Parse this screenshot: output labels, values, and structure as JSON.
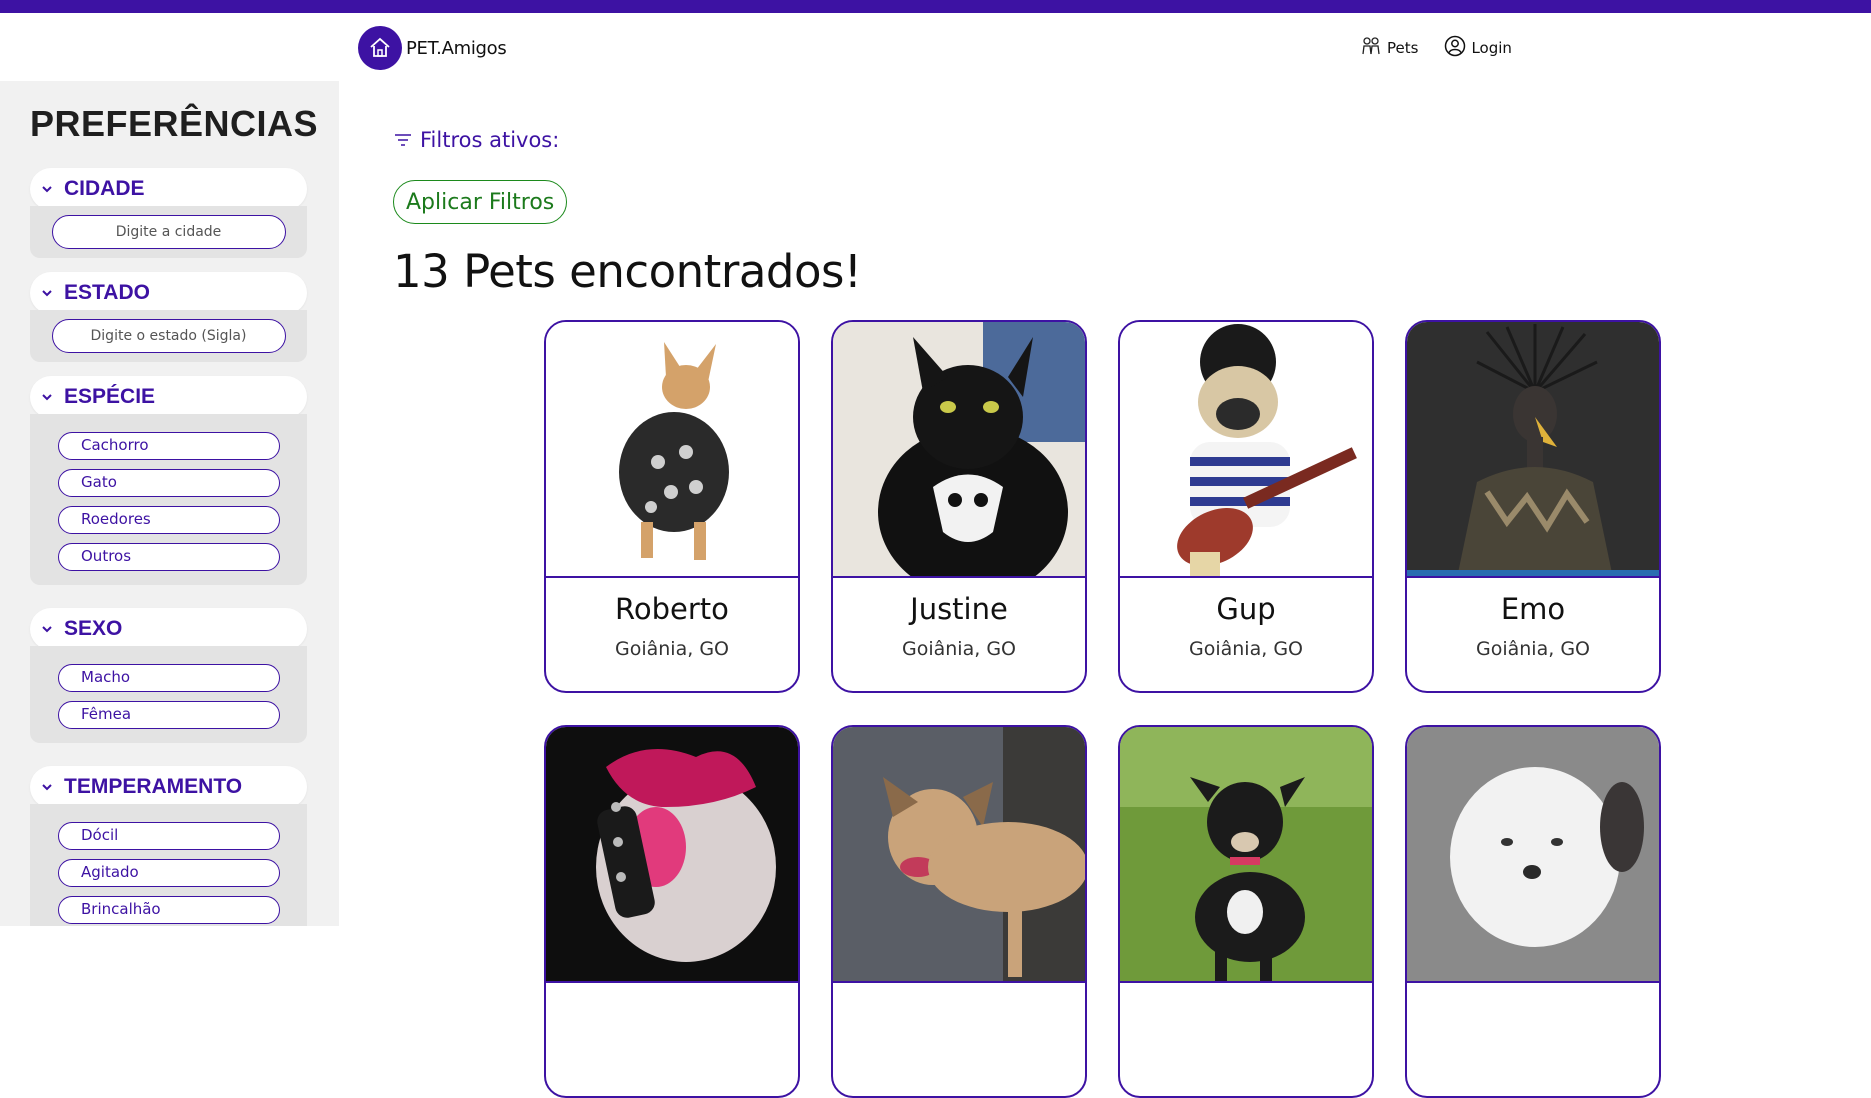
{
  "header": {
    "brand": "PET.Amigos",
    "nav": [
      {
        "label": "Pets",
        "icon": "pets-icon"
      },
      {
        "label": "Login",
        "icon": "user-circle-icon"
      }
    ]
  },
  "sidebar": {
    "title": "PREFERÊNCIAS",
    "sections": {
      "cidade": {
        "label": "CIDADE",
        "placeholder": "Digite a cidade"
      },
      "estado": {
        "label": "ESTADO",
        "placeholder": "Digite o estado (Sigla)"
      },
      "especie": {
        "label": "ESPÉCIE",
        "options": [
          "Cachorro",
          "Gato",
          "Roedores",
          "Outros"
        ]
      },
      "sexo": {
        "label": "SEXO",
        "options": [
          "Macho",
          "Fêmea"
        ]
      },
      "temperamento": {
        "label": "TEMPERAMENTO",
        "options": [
          "Dócil",
          "Agitado",
          "Brincalhão"
        ]
      }
    }
  },
  "main": {
    "filters_label": "Filtros ativos:",
    "apply_label": "Aplicar Filtros",
    "results_title": "13 Pets encontrados!",
    "pets": [
      {
        "name": "Roberto",
        "location": "Goiânia, GO"
      },
      {
        "name": "Justine",
        "location": "Goiânia, GO"
      },
      {
        "name": "Gup",
        "location": "Goiânia, GO"
      },
      {
        "name": "Emo",
        "location": "Goiânia, GO"
      },
      {
        "name": "",
        "location": ""
      },
      {
        "name": "",
        "location": ""
      },
      {
        "name": "",
        "location": ""
      },
      {
        "name": "",
        "location": ""
      }
    ]
  },
  "colors": {
    "brand": "#3d12a3",
    "apply_green": "#1c7a1c",
    "sidebar_bg": "#f1f1f1"
  }
}
